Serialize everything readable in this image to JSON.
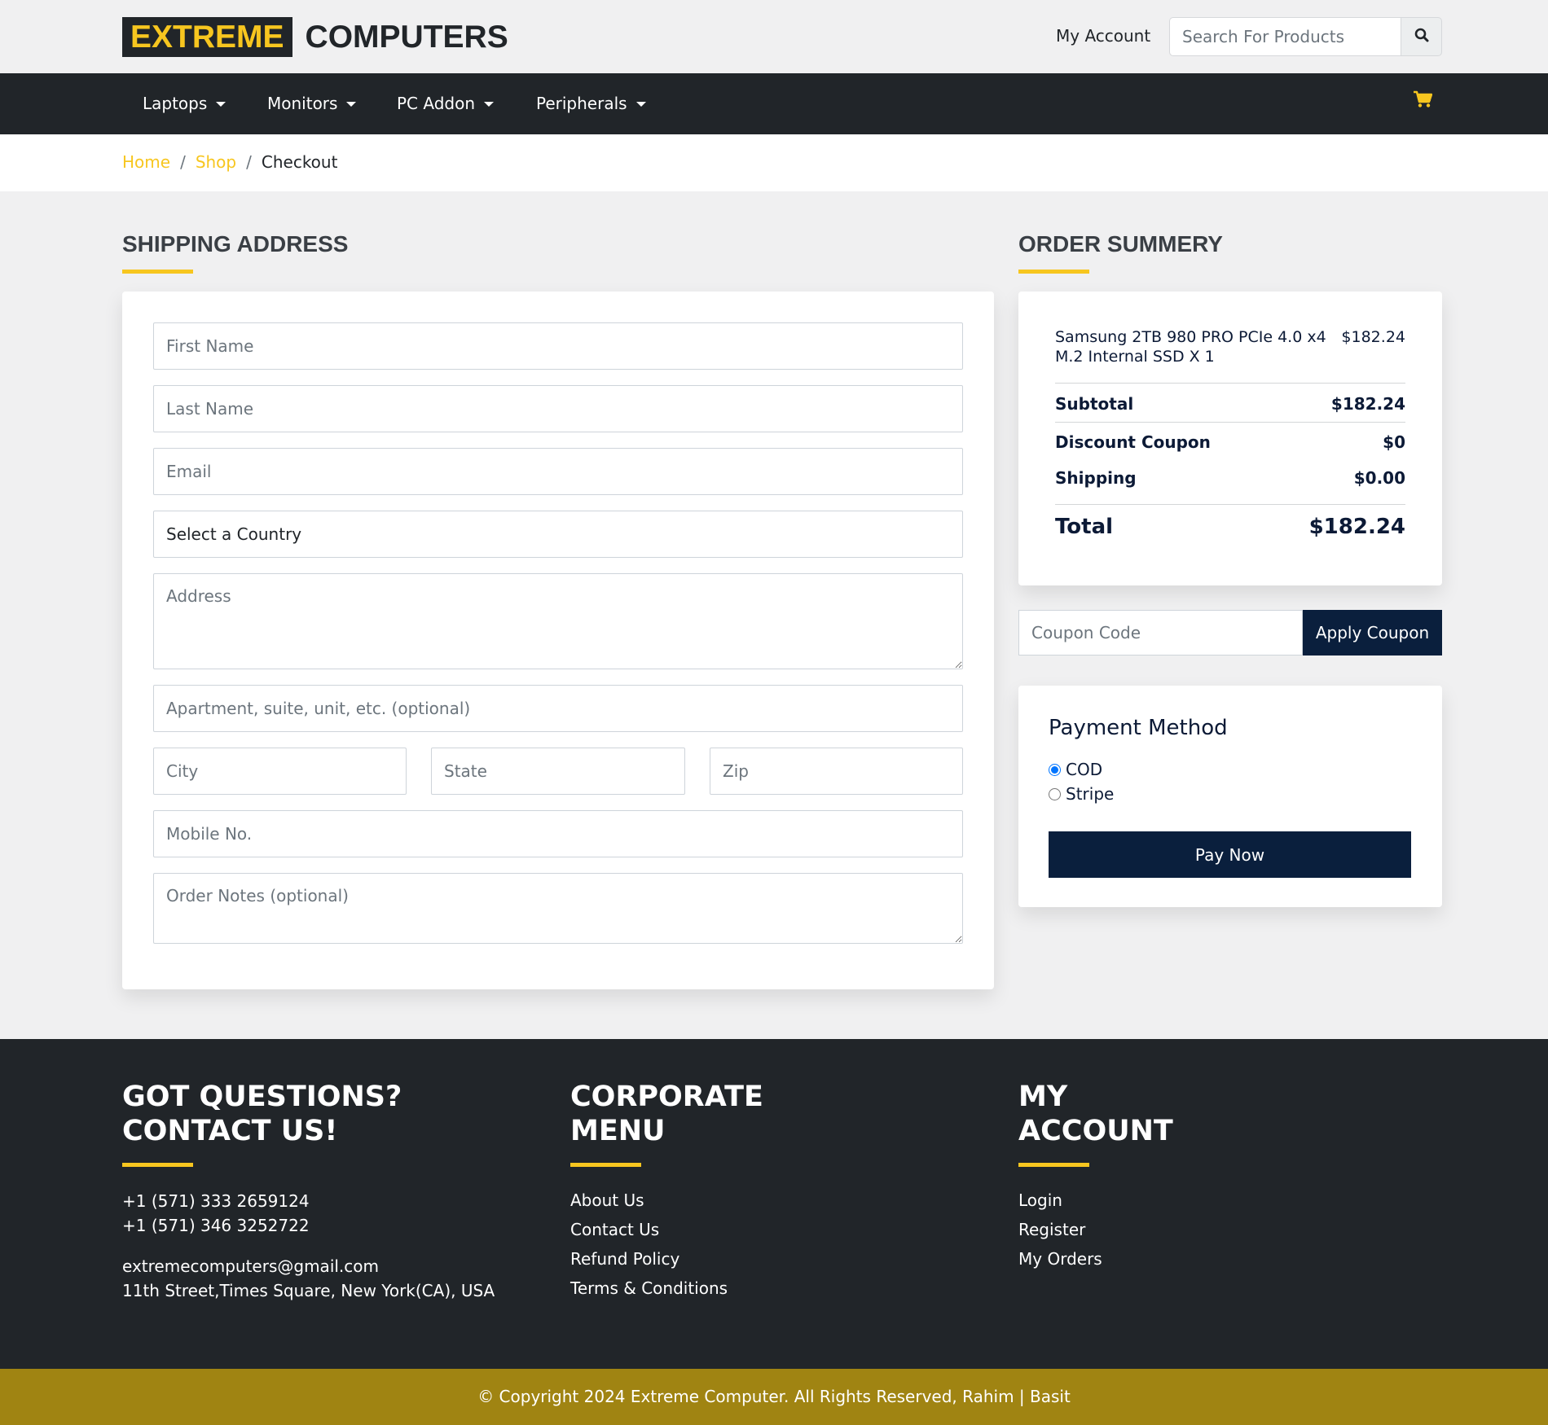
{
  "header": {
    "logo_highlight": "EXTREME",
    "logo_rest": "COMPUTERS",
    "my_account": "My Account",
    "search_placeholder": "Search For Products",
    "accent_color": "#f7c61f"
  },
  "nav": {
    "items": [
      {
        "label": "Laptops"
      },
      {
        "label": "Monitors"
      },
      {
        "label": "PC Addon"
      },
      {
        "label": "Peripherals"
      }
    ],
    "cart_icon": "cart-icon"
  },
  "breadcrumb": {
    "home": "Home",
    "shop": "Shop",
    "current": "Checkout"
  },
  "shipping": {
    "title": "SHIPPING ADDRESS",
    "first_name": "First Name",
    "last_name": "Last Name",
    "email": "Email",
    "country": "Select a Country",
    "address": "Address",
    "apartment": "Apartment, suite, unit, etc. (optional)",
    "city": "City",
    "state": "State",
    "zip": "Zip",
    "mobile": "Mobile No.",
    "notes": "Order Notes (optional)"
  },
  "summary": {
    "title": "ORDER SUMMERY",
    "product_name": "Samsung 2TB 980 PRO PCIe 4.0 x4 M.2 Internal SSD X 1",
    "product_price": "$182.24",
    "subtotal_label": "Subtotal",
    "subtotal_value": "$182.24",
    "discount_label": "Discount Coupon",
    "discount_value": "$0",
    "shipping_label": "Shipping",
    "shipping_value": "$0.00",
    "total_label": "Total",
    "total_value": "$182.24"
  },
  "coupon": {
    "placeholder": "Coupon Code",
    "button": "Apply Coupon"
  },
  "payment": {
    "title": "Payment Method",
    "options": [
      {
        "label": "COD",
        "checked": true
      },
      {
        "label": "Stripe",
        "checked": false
      }
    ],
    "pay_button": "Pay Now"
  },
  "footer": {
    "contact_title_1": "GOT QUESTIONS?",
    "contact_title_2": "CONTACT US!",
    "phone_1": "+1 (571) 333 2659124",
    "phone_2": "+1 (571) 346 3252722",
    "email": "extremecomputers@gmail.com",
    "address": "11th Street,Times Square, New York(CA), USA",
    "corporate_title_1": "CORPORATE",
    "corporate_title_2": "MENU",
    "corporate_links": [
      "About Us",
      "Contact Us",
      "Refund Policy",
      "Terms & Conditions"
    ],
    "account_title_1": "MY",
    "account_title_2": "ACCOUNT",
    "account_links": [
      "Login",
      "Register",
      "My Orders"
    ],
    "copyright": "© Copyright 2024 Extreme Computer. All Rights Reserved, Rahim | Basit"
  }
}
